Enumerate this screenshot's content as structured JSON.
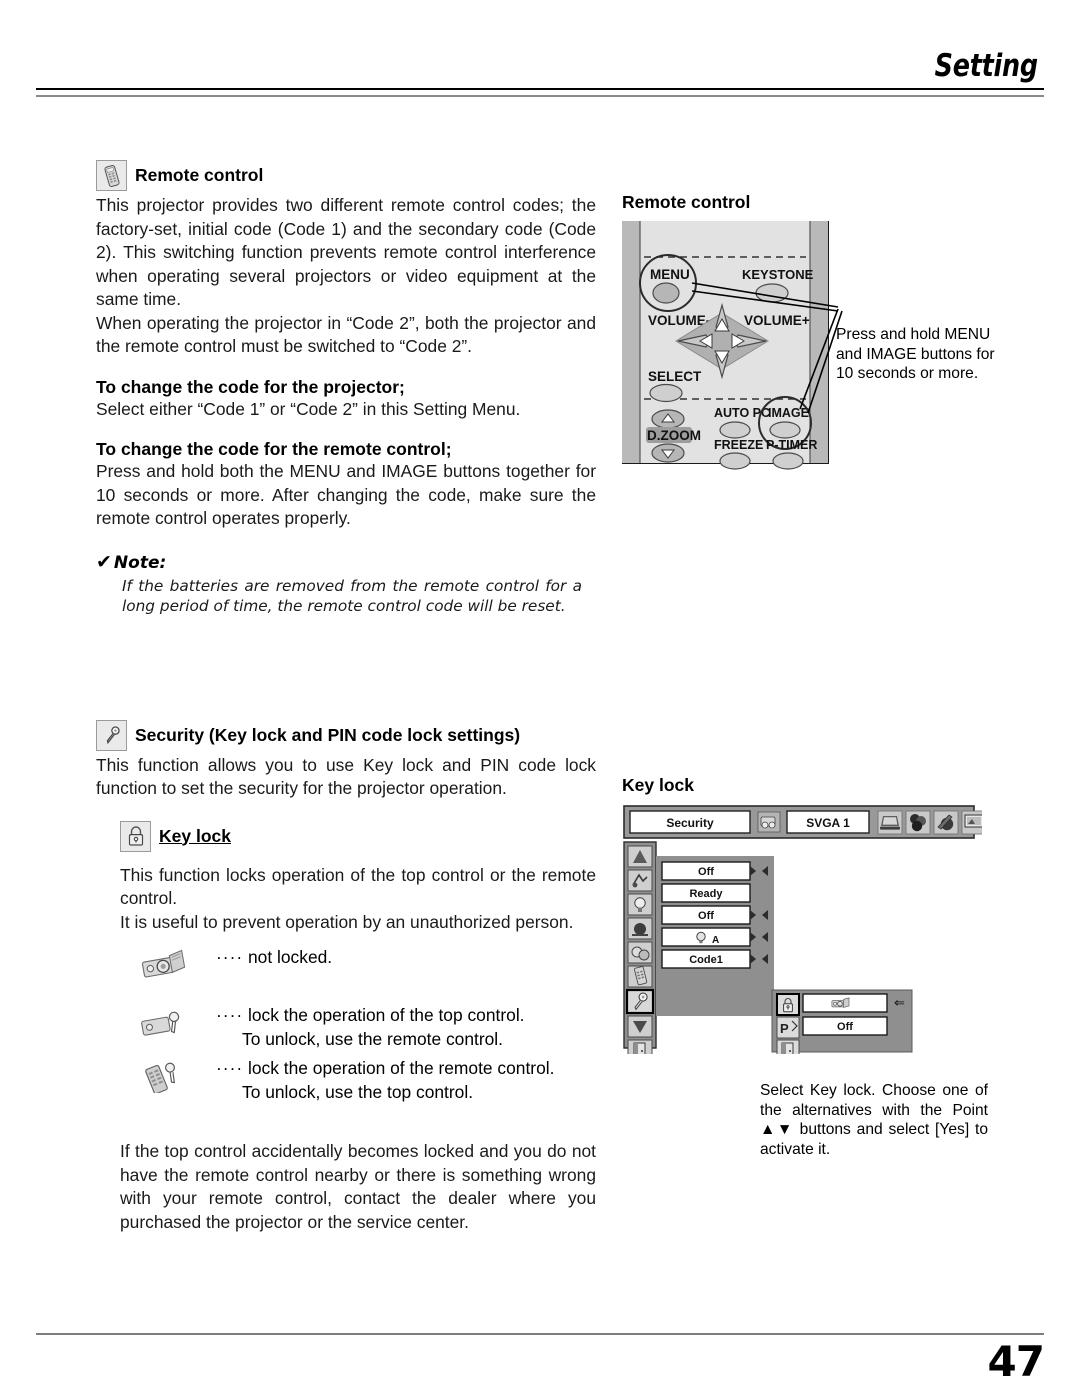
{
  "header": {
    "title": "Setting"
  },
  "footer": {
    "page_number": "47"
  },
  "left": {
    "remote": {
      "icon": "remote-control-icon",
      "heading": "Remote control",
      "paragraphs": [
        "This projector provides two different remote control codes; the factory-set, initial code (Code 1) and the secondary code (Code 2).  This switching function prevents remote control interference when operating several projectors or video equipment at the same time.",
        "When operating the projector in “Code 2”,  both the projector and the remote control must be switched to “Code 2”."
      ],
      "projector_subhead": "To change the code for the projector;",
      "projector_body": "Select either “Code 1” or “Code 2” in this Setting Menu.",
      "remote_subhead": "To change the code for the remote control;",
      "remote_body": "Press and hold both the MENU and IMAGE buttons together for 10 seconds or more.  After changing the code, make sure the  remote control operates properly."
    },
    "note": {
      "check": "✔",
      "label": "Note:",
      "text": "If the batteries are removed from the remote control for a long period of time, the remote control code will be reset."
    },
    "security": {
      "icon": "key-icon",
      "heading": "Security (Key lock and PIN code lock settings)",
      "body": "This function allows you to use Key lock and PIN code lock function to set the security for the projector operation."
    },
    "keylock": {
      "icon": "padlock-icon",
      "heading": "Key lock",
      "body1": "This function locks operation of the top control or the remote control.",
      "body2": "It is useful to prevent operation by an unauthorized person.",
      "options": [
        {
          "icon": "projector-remote-unlocked-icon",
          "dots": "····",
          "text": "not locked.",
          "sub": ""
        },
        {
          "icon": "projector-locked-icon",
          "dots": "····",
          "text": "lock the operation of the top control.",
          "sub": "To unlock, use the remote control."
        },
        {
          "icon": "remote-locked-icon",
          "dots": "····",
          "text": "lock the operation of the remote control.",
          "sub": "To unlock, use the top control."
        }
      ],
      "closing": "If the top control accidentally becomes locked and you do not have the remote control nearby or there is something wrong with your remote control, contact the dealer where you purchased the projector or the service center."
    }
  },
  "right": {
    "remote_figure": {
      "heading": "Remote control",
      "buttons": {
        "menu": "MENU",
        "keystone": "KEYSTONE",
        "volume_down": "VOLUME-",
        "volume_up": "VOLUME+",
        "select": "SELECT",
        "auto_pc": "AUTO PC",
        "image": "IMAGE",
        "d_zoom": "D.ZOOM",
        "freeze": "FREEZE",
        "p_timer": "P-TIMER"
      },
      "callout": "Press and hold MENU and IMAGE buttons for 10 seconds or more."
    },
    "keylock_figure": {
      "heading": "Key lock",
      "menubar": {
        "title": "Security",
        "source_icon": "source-icon",
        "source": "SVGA 1",
        "icons": [
          "computer-icon",
          "color-adjust-icon",
          "image-select-icon",
          "screen-icon",
          "sound-icon",
          "setting-icon"
        ],
        "selected_icon_index": 5
      },
      "sidebar_icons": [
        "keystone-icon",
        "blue-back-icon",
        "display-icon",
        "logo-icon",
        "ceiling-rear-icon",
        "remote-control-icon",
        "security-key-icon",
        "down-arrow-icon",
        "quit-icon"
      ],
      "selected_sidebar_index": 6,
      "items": [
        {
          "value": "Off",
          "arrows": true
        },
        {
          "value": "Ready",
          "arrows": false
        },
        {
          "value": "Off",
          "arrows": true
        },
        {
          "value": "",
          "arrows": true,
          "icon": "lamp-auto-icon"
        },
        {
          "value": "Code1",
          "arrows": true
        }
      ],
      "dialog": {
        "rows": [
          {
            "icon": "padlock-icon",
            "value": "",
            "value_icon": "projector-remote-icon",
            "pointer": "⇐",
            "selected": true
          },
          {
            "icon": "pin-code-icon",
            "value": "Off",
            "selected": false
          },
          {
            "icon": "quit-icon",
            "value": "",
            "selected": false
          }
        ]
      },
      "caption": "Select Key lock.  Choose one of the alternatives with the Point ▲▼ buttons and select [Yes] to activate it."
    }
  }
}
